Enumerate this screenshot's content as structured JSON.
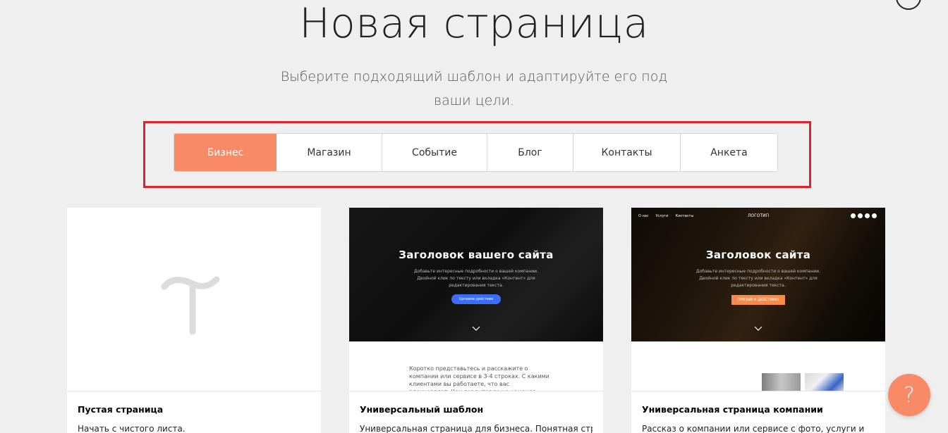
{
  "header": {
    "title": "Новая страница",
    "subtitle_line1": "Выберите подходящий шаблон и адаптируйте его под",
    "subtitle_line2": "ваши цели."
  },
  "tabs": [
    {
      "label": "Бизнес",
      "active": true
    },
    {
      "label": "Магазин",
      "active": false
    },
    {
      "label": "Событие",
      "active": false
    },
    {
      "label": "Блог",
      "active": false
    },
    {
      "label": "Контакты",
      "active": false
    },
    {
      "label": "Анкета",
      "active": false
    }
  ],
  "cards": [
    {
      "title": "Пустая страница",
      "description": "Начать с чистого листа."
    },
    {
      "title": "Универсальный шаблон",
      "description": "Универсальная страница для бизнеса. Понятная структура,",
      "preview": {
        "heading": "Заголовок вашего сайта",
        "text": "Добавьте интересные подробности о вашей компании. Двойной клик по тексту или вкладка «Контент» для редактирования текста.",
        "button": "Целевое действие",
        "lower_text": "Коротко представьтесь и расскажите о компании или сервисе в 3-4 строках. С какими клиентами вы работаете, что вас вдохновляет. Чем гордится ваша команда, какие у нее ценности и мотивация"
      }
    },
    {
      "title": "Универсальная страница компании",
      "description": "Рассказ о компании или сервисе с фото, услуги и",
      "preview": {
        "nav": [
          "О нас",
          "Услуги",
          "Контакты"
        ],
        "logo": "ЛОГОТИП",
        "heading": "Заголовок сайта",
        "text": "Добавьте интересные подробности о вашей компании. Двойной клик по тексту или вкладка «Контент» для редактирования текста.",
        "button": "ПРИЗЫВ К ДЕЙСТВИЮ"
      }
    }
  ],
  "help": {
    "label": "?"
  },
  "colors": {
    "accent": "#f98a68",
    "highlight_border": "#e0212e",
    "background": "#efefef"
  }
}
